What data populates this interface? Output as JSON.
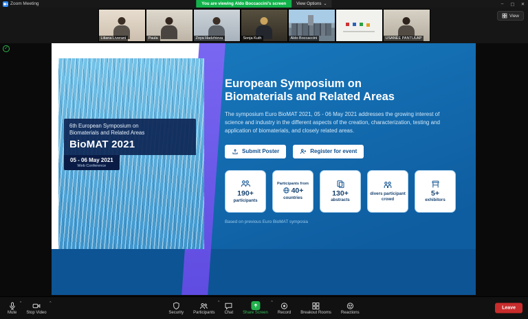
{
  "colors": {
    "banner_green": "#12B24B",
    "slide_blue": "#0E5DA0",
    "accent_purple": "#6A5BE0",
    "share_green": "#23B14D",
    "leave_red": "#C92C2C",
    "card_border_blue": "#A6CFEE"
  },
  "icons": {
    "chevron_down": "⌄",
    "chevron_up": "^",
    "check": "✓"
  },
  "titlebar": {
    "app_title": "Zoom Meeting",
    "banner": "You are viewing Aldo Boccaccini's screen",
    "view_options": "View Options",
    "controls": {
      "minimize": "–",
      "maximize": "▢",
      "close": "✕"
    }
  },
  "strip": {
    "view_label": "View"
  },
  "participants": [
    {
      "name": "Liliana Liverani"
    },
    {
      "name": "Paula"
    },
    {
      "name": "Zoya Hadzhieva"
    },
    {
      "name": "Sonja Kuth"
    },
    {
      "name": "Aldo Boccaccini"
    },
    {
      "name": ""
    },
    {
      "name": "USANEE PANTULAP"
    }
  ],
  "slide": {
    "hero": {
      "line1": "6th European Symposium on",
      "line2": "Biomaterials and Related Areas",
      "title": "BioMAT 2021",
      "date": "05 - 06 May 2021",
      "mode": "Web Conference"
    },
    "heading_line1": "European Symposium on",
    "heading_line2": "Biomaterials and Related Areas",
    "description": "The symposium Euro BioMAT 2021, 05 - 06 May 2021 addresses the growing interest of science and industry in the different aspects of the creation, characterization, testing and application of biomaterials, and closely related areas.",
    "buttons": {
      "submit": "Submit Poster",
      "register": "Register for event"
    },
    "stats": [
      {
        "value": "190+",
        "label": "participants"
      },
      {
        "pre": "Participants from",
        "value": "40+",
        "label": "countries"
      },
      {
        "value": "130+",
        "label": "abstracts"
      },
      {
        "label": "divers participant crowd"
      },
      {
        "value": "5+",
        "label": "exhibitors"
      }
    ],
    "footnote": "Based on previous Euro BioMAT symposia"
  },
  "toolbar": {
    "mute": "Mute",
    "stop_video": "Stop Video",
    "items": [
      {
        "label": "Security"
      },
      {
        "label": "Participants"
      },
      {
        "label": "Chat"
      },
      {
        "label": "Share Screen"
      },
      {
        "label": "Record"
      },
      {
        "label": "Breakout Rooms"
      },
      {
        "label": "Reactions"
      }
    ],
    "leave": "Leave"
  }
}
